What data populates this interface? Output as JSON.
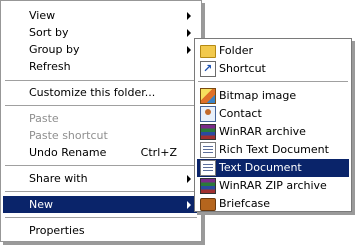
{
  "context_menu": {
    "items": [
      {
        "label": "View",
        "submenu": true
      },
      {
        "label": "Sort by",
        "submenu": true
      },
      {
        "label": "Group by",
        "submenu": true
      },
      {
        "label": "Refresh"
      },
      {
        "label": "Customize this folder..."
      },
      {
        "label": "Paste",
        "disabled": true
      },
      {
        "label": "Paste shortcut",
        "disabled": true
      },
      {
        "label": "Undo Rename",
        "shortcut": "Ctrl+Z"
      },
      {
        "label": "Share with",
        "submenu": true
      },
      {
        "label": "New",
        "submenu": true,
        "highlighted": true
      },
      {
        "label": "Properties"
      }
    ]
  },
  "new_submenu": {
    "items": [
      {
        "label": "Folder",
        "icon": "folder-icon"
      },
      {
        "label": "Shortcut",
        "icon": "shortcut-icon"
      },
      {
        "label": "Bitmap image",
        "icon": "bitmap-icon"
      },
      {
        "label": "Contact",
        "icon": "contact-icon"
      },
      {
        "label": "WinRAR archive",
        "icon": "winrar-icon"
      },
      {
        "label": "Rich Text Document",
        "icon": "rtf-icon"
      },
      {
        "label": "Text Document",
        "icon": "text-document-icon",
        "highlighted": true
      },
      {
        "label": "WinRAR ZIP archive",
        "icon": "winrar-zip-icon"
      },
      {
        "label": "Briefcase",
        "icon": "briefcase-icon"
      }
    ]
  },
  "colors": {
    "highlight": "#0a246a",
    "disabled_text": "#8f8f8f"
  }
}
